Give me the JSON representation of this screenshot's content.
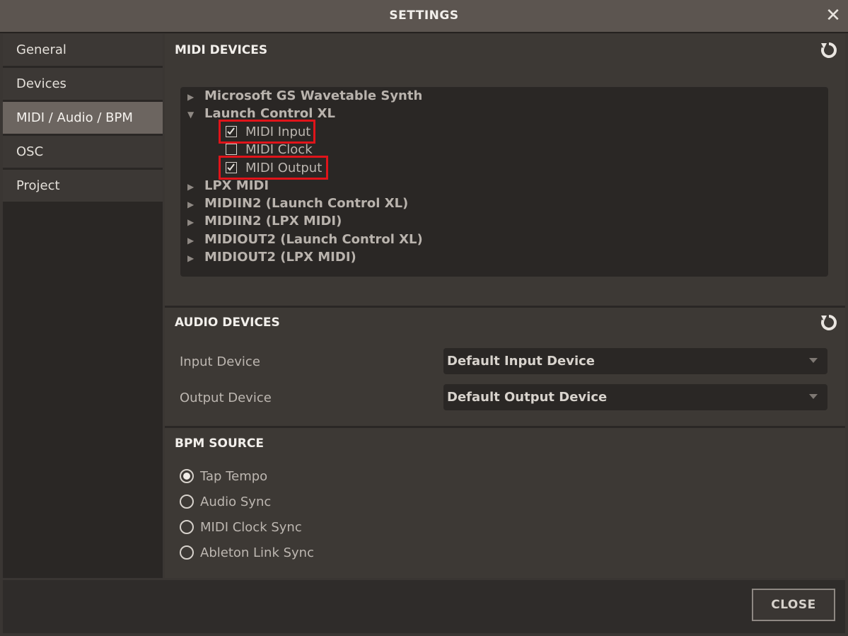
{
  "window": {
    "title": "SETTINGS",
    "close_icon": "close-icon"
  },
  "sidebar": {
    "items": [
      {
        "label": "General",
        "active": false
      },
      {
        "label": "Devices",
        "active": false
      },
      {
        "label": "MIDI / Audio / BPM",
        "active": true
      },
      {
        "label": "OSC",
        "active": false
      },
      {
        "label": "Project",
        "active": false
      }
    ]
  },
  "midi": {
    "title": "MIDI DEVICES",
    "refresh_icon": "refresh-icon",
    "devices": [
      {
        "name": "Microsoft GS Wavetable Synth",
        "expanded": false
      },
      {
        "name": "Launch Control XL",
        "expanded": true,
        "options": [
          {
            "label": "MIDI Input",
            "checked": true,
            "highlighted": true
          },
          {
            "label": "MIDI Clock",
            "checked": false,
            "highlighted": false
          },
          {
            "label": "MIDI Output",
            "checked": true,
            "highlighted": true
          }
        ]
      },
      {
        "name": "LPX MIDI",
        "expanded": false
      },
      {
        "name": "MIDIIN2 (Launch Control XL)",
        "expanded": false
      },
      {
        "name": "MIDIIN2 (LPX MIDI)",
        "expanded": false
      },
      {
        "name": "MIDIOUT2 (Launch Control XL)",
        "expanded": false
      },
      {
        "name": "MIDIOUT2 (LPX MIDI)",
        "expanded": false
      }
    ]
  },
  "audio": {
    "title": "AUDIO DEVICES",
    "refresh_icon": "refresh-icon",
    "input_label": "Input Device",
    "input_value": "Default Input Device",
    "output_label": "Output Device",
    "output_value": "Default Output Device"
  },
  "bpm": {
    "title": "BPM SOURCE",
    "options": [
      {
        "label": "Tap Tempo",
        "selected": true
      },
      {
        "label": "Audio Sync",
        "selected": false
      },
      {
        "label": "MIDI Clock Sync",
        "selected": false
      },
      {
        "label": "Ableton Link Sync",
        "selected": false
      }
    ]
  },
  "footer": {
    "close_label": "CLOSE"
  },
  "colors": {
    "highlight": "#e0141a",
    "active_nav": "#6c6560",
    "panel": "#3d3935",
    "dark": "#2a2725"
  }
}
